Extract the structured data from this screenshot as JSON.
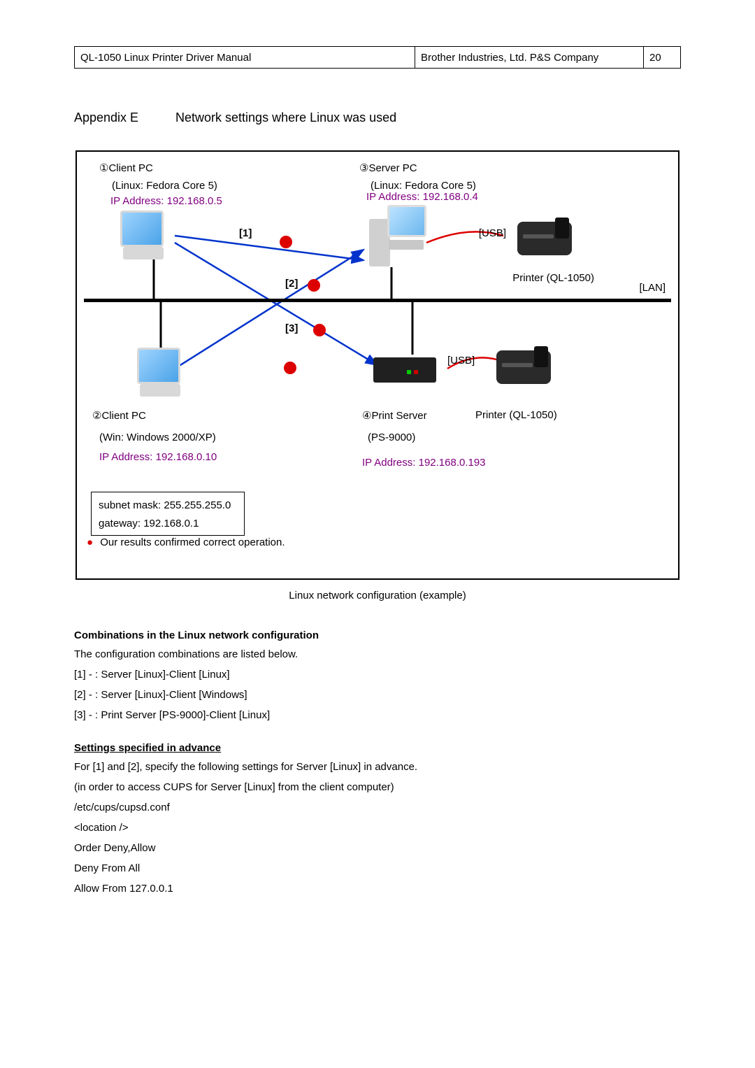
{
  "header": {
    "left": "QL-1050 Linux Printer Driver Manual",
    "mid": "Brother Industries, Ltd. P&S Company",
    "page": "20"
  },
  "title": {
    "appendix": "Appendix E",
    "text": "Network settings where Linux was used"
  },
  "diagram": {
    "client1": {
      "num": "①",
      "name": "Client PC",
      "os": "(Linux: Fedora Core 5)",
      "ip": "IP Address: 192.168.0.5"
    },
    "server": {
      "num": "③",
      "name": "Server PC",
      "os": "(Linux: Fedora Core 5)",
      "ip": "IP Address: 192.168.0.4"
    },
    "client2": {
      "num": "②",
      "name": "Client PC",
      "os": "(Win: Windows 2000/XP)",
      "ip": "IP Address: 192.168.0.10"
    },
    "pserver": {
      "num": "④",
      "name": "Print Server",
      "model": "(PS-9000)",
      "ip": "IP Address: 192.168.0.193"
    },
    "printer1": "Printer (QL-1050)",
    "printer2": "Printer (QL-1050)",
    "usb": "[USB]",
    "lan": "[LAN]",
    "tags": {
      "t1": "[1]",
      "t2": "[2]",
      "t3": "[3]"
    },
    "subnet": "subnet mask: 255.255.255.0",
    "gateway": "gateway: 192.168.0.1",
    "confirm": "Our results confirmed correct operation."
  },
  "caption": "Linux network configuration (example)",
  "combos": {
    "title": "Combinations in the Linux network configuration",
    "intro": "The configuration combinations are listed below.",
    "r1": "[1]   -   : Server [Linux]-Client [Linux]",
    "r2": "[2]   -   : Server [Linux]-Client [Windows]",
    "r3": "[3]   -   : Print Server [PS-9000]-Client [Linux]"
  },
  "settings": {
    "title": "Settings specified in advance",
    "l1": "For [1] and [2], specify the following settings for Server [Linux] in advance.",
    "l2": "(in order to access CUPS for Server [Linux] from the client computer)",
    "l3": "/etc/cups/cupsd.conf",
    "l4": "<location />",
    "l5": "Order Deny,Allow",
    "l6": "Deny From All",
    "l7": "Allow From 127.0.0.1"
  }
}
